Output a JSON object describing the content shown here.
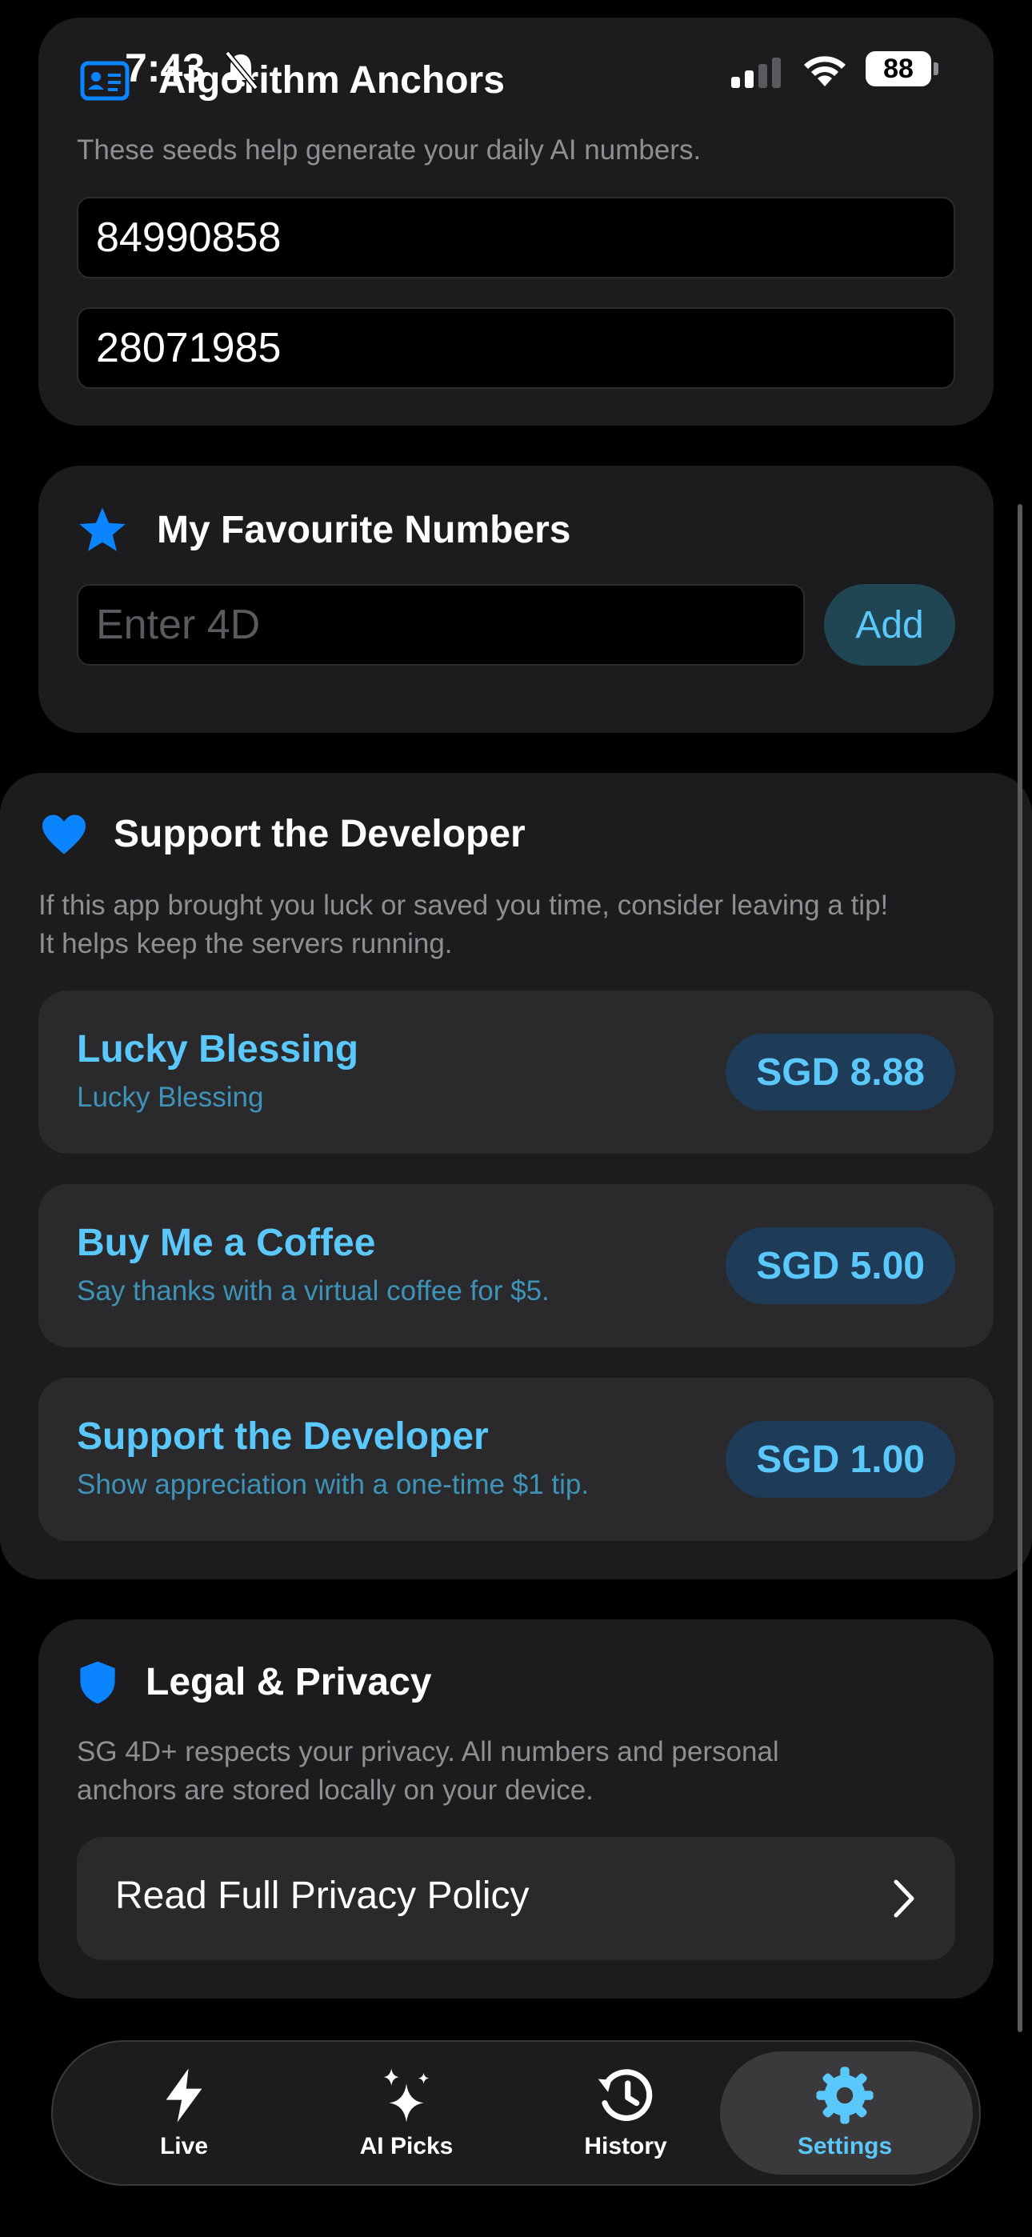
{
  "status_bar": {
    "time": "7:43",
    "battery": "88"
  },
  "anchors": {
    "title": "Algorithm Anchors",
    "description": "These seeds help generate your daily AI numbers.",
    "seed1": "84990858",
    "seed2": "28071985"
  },
  "favourites": {
    "title": "My Favourite Numbers",
    "placeholder": "Enter 4D",
    "add_label": "Add"
  },
  "support": {
    "title": "Support the Developer",
    "description_line1": "If this app brought you luck or saved you time, consider leaving a tip!",
    "description_line2": "It helps keep the servers running.",
    "tips": [
      {
        "name": "Lucky Blessing",
        "subtitle": "Lucky Blessing",
        "price": "SGD 8.88"
      },
      {
        "name": "Buy Me a Coffee",
        "subtitle": "Say thanks with a virtual coffee for $5.",
        "price": "SGD 5.00"
      },
      {
        "name": "Support the Developer",
        "subtitle": "Show appreciation with a one-time $1 tip.",
        "price": "SGD 1.00"
      }
    ]
  },
  "legal": {
    "title": "Legal & Privacy",
    "description_line1": "SG 4D+ respects your privacy. All numbers and personal",
    "description_line2": "anchors are stored locally on your device.",
    "policy_link": "Read Full Privacy Policy"
  },
  "tab_bar": {
    "items": [
      {
        "label": "Live",
        "icon": "bolt-icon"
      },
      {
        "label": "AI Picks",
        "icon": "sparkles-icon"
      },
      {
        "label": "History",
        "icon": "history-clock-icon"
      },
      {
        "label": "Settings",
        "icon": "gear-icon",
        "active": true
      }
    ]
  },
  "colors": {
    "accent": "#5ac8fa",
    "blue_icon": "#0a84ff",
    "card_bg": "#1c1c1e",
    "price_bg": "#1e3b57"
  }
}
